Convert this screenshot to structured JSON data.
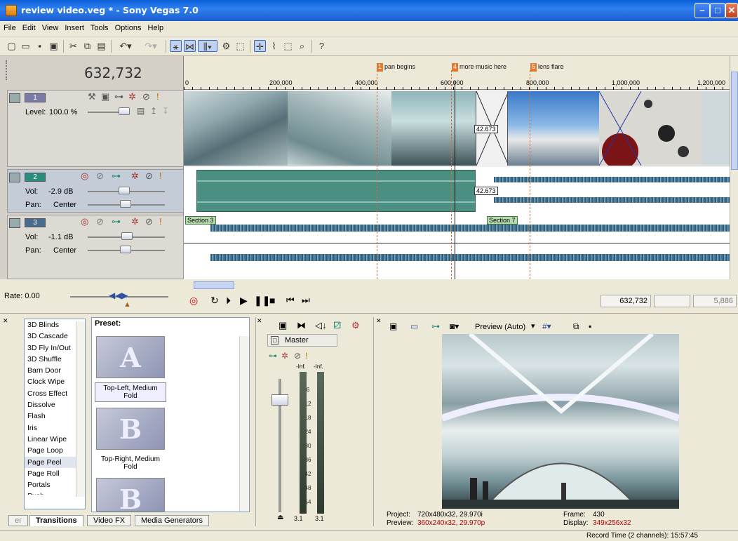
{
  "window": {
    "title": "review video.veg * - Sony Vegas 7.0",
    "min": "–",
    "max": "□",
    "close": "✕"
  },
  "menu": [
    "File",
    "Edit",
    "View",
    "Insert",
    "Tools",
    "Options",
    "Help"
  ],
  "timecode": "632,732",
  "markers": [
    {
      "num": "1",
      "label": "pan begins"
    },
    {
      "num": "4",
      "label": "more music here"
    },
    {
      "num": "5",
      "label": "lens flare"
    }
  ],
  "ruler_ticks": [
    "0",
    "200,000",
    "400,000",
    "600,000",
    "800,000",
    "1,000,000",
    "1,200,000"
  ],
  "tracks": [
    {
      "num": "1",
      "level_label": "Level:",
      "level_value": "100.0 %"
    },
    {
      "num": "2",
      "vol_label": "Vol:",
      "vol_value": "-2.9 dB",
      "pan_label": "Pan:",
      "pan_value": "Center"
    },
    {
      "num": "3",
      "vol_label": "Vol:",
      "vol_value": "-1.1 dB",
      "pan_label": "Pan:",
      "pan_value": "Center"
    }
  ],
  "crossfade_label": "42.673",
  "sections": [
    "Section 3",
    "Section 7"
  ],
  "rate": "Rate: 0.00",
  "transport_time": "632,732",
  "transport_time2": "5,886",
  "transitions": {
    "list": [
      "3D Blinds",
      "3D Cascade",
      "3D Fly In/Out",
      "3D Shuffle",
      "Barn Door",
      "Clock Wipe",
      "Cross Effect",
      "Dissolve",
      "Flash",
      "Iris",
      "Linear Wipe",
      "Page Loop",
      "Page Peel",
      "Page Roll",
      "Portals",
      "Push"
    ],
    "selected": "Page Peel",
    "preset_label": "Preset:",
    "presets": [
      {
        "letter": "A",
        "name": "Top-Left, Medium Fold"
      },
      {
        "letter": "B",
        "name": "Top-Right, Medium Fold"
      },
      {
        "letter": "B",
        "name": ""
      }
    ]
  },
  "tabs": [
    "er",
    "Transitions",
    "Video FX",
    "Media Generators"
  ],
  "mixer": {
    "title": "Master",
    "peak_left": "-Inf.",
    "peak_right": "-Inf.",
    "scale": [
      "6",
      "12",
      "18",
      "24",
      "30",
      "36",
      "42",
      "48",
      "54"
    ],
    "val_left": "3.1",
    "val_right": "3.1"
  },
  "preview": {
    "mode": "Preview (Auto)",
    "project_label": "Project:",
    "project_value": "720x480x32, 29.970i",
    "preview_label": "Preview:",
    "preview_value": "360x240x32, 29.970p",
    "frame_label": "Frame:",
    "frame_value": "430",
    "display_label": "Display:",
    "display_value": "349x256x32"
  },
  "status": "Record Time (2 channels): 15:57:45",
  "colors": {
    "accent_red": "#b00000",
    "marker": "#e07a30",
    "audio_wave": "#2d5d78"
  }
}
